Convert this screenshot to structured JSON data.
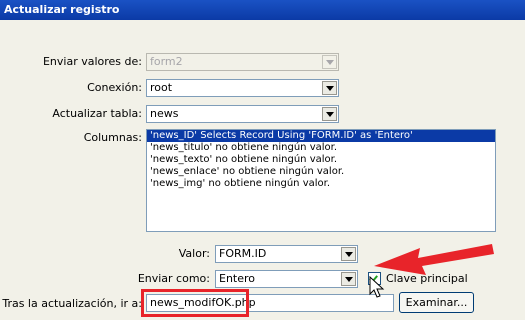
{
  "window": {
    "title": "Actualizar registro"
  },
  "form": {
    "enviar_valores": {
      "label": "Enviar valores de:",
      "value": "form2"
    },
    "conexion": {
      "label": "Conexión:",
      "value": "root"
    },
    "actualizar_tabla": {
      "label": "Actualizar tabla:",
      "value": "news"
    },
    "columnas": {
      "label": "Columnas:",
      "items": [
        "'news_ID' Selects Record Using 'FORM.ID' as 'Entero'",
        "'news_titulo' no obtiene ningún valor.",
        "'news_texto' no obtiene ningún valor.",
        "'news_enlace' no obtiene ningún valor.",
        "'news_img' no obtiene ningún valor."
      ],
      "selected_index": 0
    },
    "valor": {
      "label": "Valor:",
      "value": "FORM.ID"
    },
    "enviar_como": {
      "label": "Enviar como:",
      "value": "Entero"
    },
    "clave_principal": {
      "label": "Clave principal",
      "checked": true
    },
    "tras_actualizacion": {
      "label": "Tras la actualización, ir a:",
      "value": "news_modifOK.php"
    },
    "examinar_button": "Examinar..."
  },
  "annotations": {
    "highlight_color": "#e8242a",
    "arrow_color": "#e8242a"
  }
}
